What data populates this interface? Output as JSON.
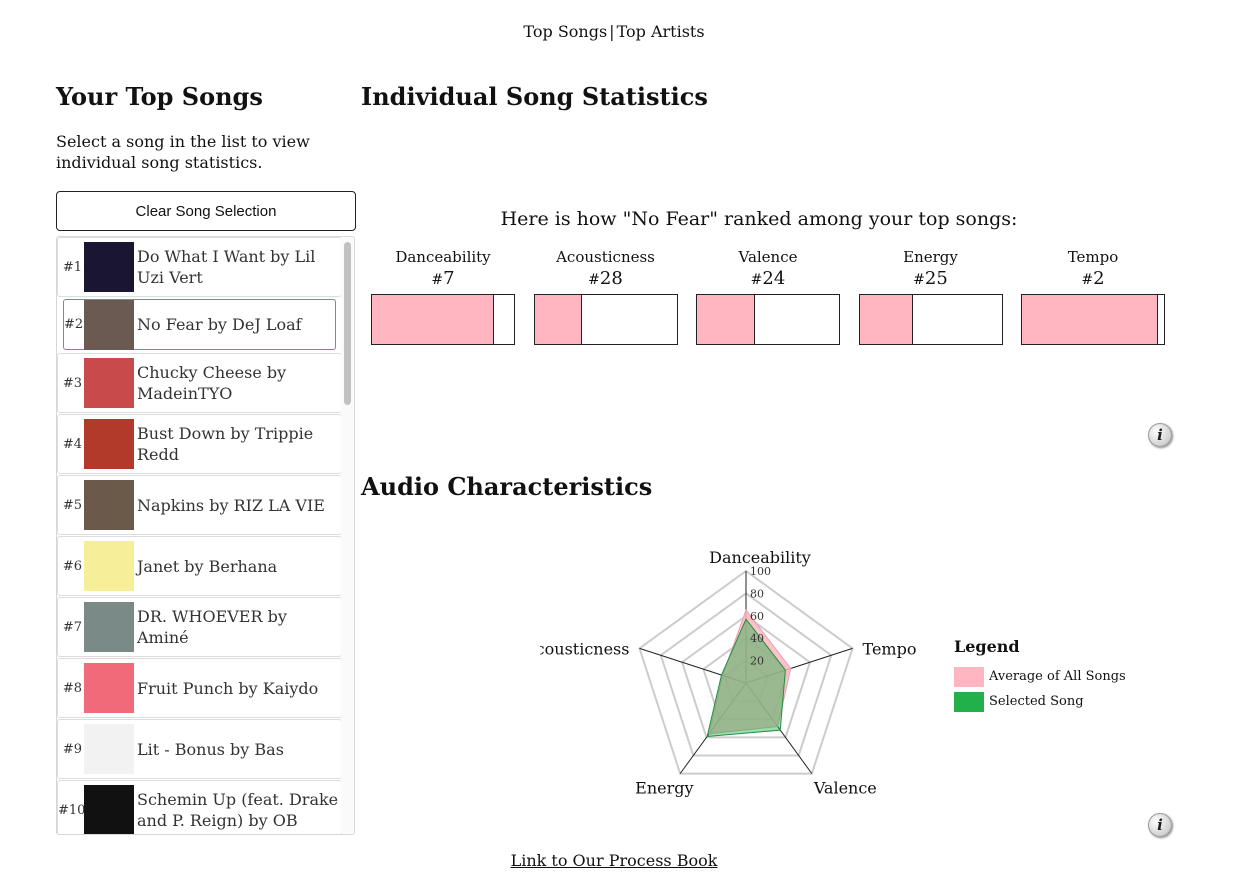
{
  "nav": {
    "top_songs": "Top Songs",
    "separator": "|",
    "top_artists": "Top Artists"
  },
  "left": {
    "title": "Your Top Songs",
    "description": "Select a song in the list to view individual song statistics.",
    "clear_button": "Clear Song Selection",
    "songs": [
      {
        "rank": "#1",
        "label": "Do What I Want by Lil Uzi Vert",
        "thumb_color": "#1a1530"
      },
      {
        "rank": "#2",
        "label": "No Fear by DeJ Loaf",
        "thumb_color": "#6b5a52",
        "selected": true
      },
      {
        "rank": "#3",
        "label": "Chucky Cheese by MadeinTYO",
        "thumb_color": "#c94a4a"
      },
      {
        "rank": "#4",
        "label": "Bust Down by Trippie Redd",
        "thumb_color": "#b23a2a"
      },
      {
        "rank": "#5",
        "label": "Napkins by RIZ LA VIE",
        "thumb_color": "#6b5a4a"
      },
      {
        "rank": "#6",
        "label": "Janet by Berhana",
        "thumb_color": "#f7ee9a"
      },
      {
        "rank": "#7",
        "label": "DR. WHOEVER by Aminé",
        "thumb_color": "#7a8a86"
      },
      {
        "rank": "#8",
        "label": "Fruit Punch by Kaiydo",
        "thumb_color": "#f06a7a"
      },
      {
        "rank": "#9",
        "label": "Lit - Bonus by Bas",
        "thumb_color": "#f2f2f2"
      },
      {
        "rank": "#10",
        "label": "Schemin Up (feat. Drake and P. Reign) by OB",
        "thumb_color": "#111111"
      }
    ]
  },
  "stats": {
    "title": "Individual Song Statistics",
    "heading": "Here is how \"No Fear\" ranked among your top songs:",
    "items": [
      {
        "name": "Danceability",
        "rank_number": "7",
        "fill_fraction": 0.85
      },
      {
        "name": "Acousticness",
        "rank_number": "28",
        "fill_fraction": 0.33
      },
      {
        "name": "Valence",
        "rank_number": "24",
        "fill_fraction": 0.4
      },
      {
        "name": "Energy",
        "rank_number": "25",
        "fill_fraction": 0.37
      },
      {
        "name": "Tempo",
        "rank_number": "2",
        "fill_fraction": 0.95
      }
    ],
    "info_icon": "i"
  },
  "audio": {
    "title": "Audio Characteristics",
    "info_icon": "i",
    "legend": {
      "title": "Legend",
      "average_label": "Average of All Songs",
      "selected_label": "Selected Song",
      "average_color": "#ffb6c1",
      "selected_color": "#22b04b"
    }
  },
  "chart_data": {
    "type": "radar",
    "axes": [
      "Danceability",
      "Tempo",
      "Valence",
      "Energy",
      "Acousticness"
    ],
    "ticks": [
      "20",
      "40",
      "60",
      "80",
      "100"
    ],
    "range": [
      0,
      100
    ],
    "series": [
      {
        "name": "Average of All Songs",
        "values": [
          65,
          42,
          48,
          56,
          22
        ]
      },
      {
        "name": "Selected Song",
        "values": [
          57,
          37,
          52,
          59,
          23
        ]
      }
    ]
  },
  "footer": {
    "process_book_link": "Link to Our Process Book"
  }
}
